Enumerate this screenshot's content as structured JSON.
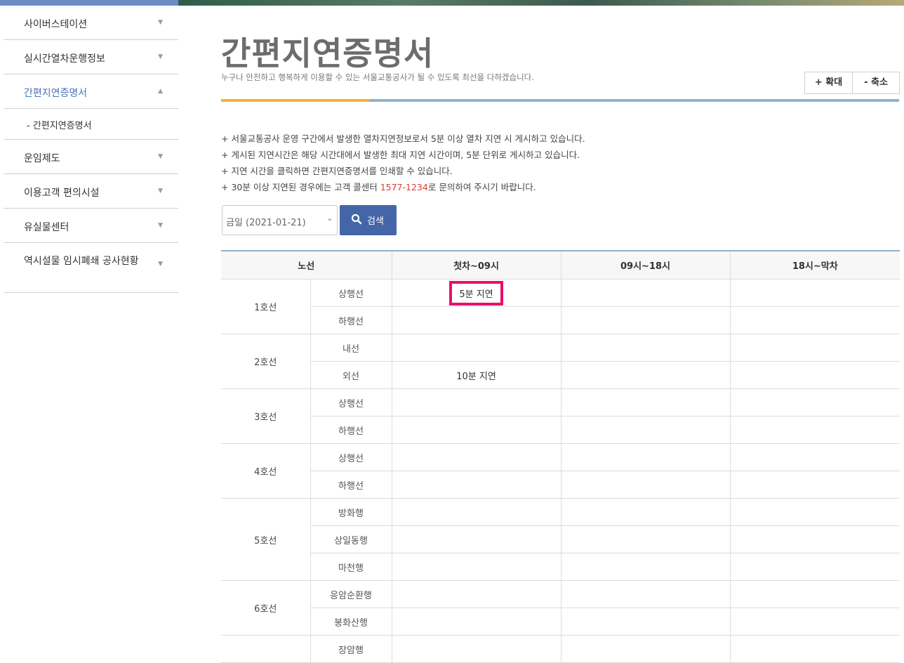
{
  "sidebar": {
    "items": [
      {
        "label": "사이버스테이션",
        "arrow": "▼"
      },
      {
        "label": "실시간열차운행정보",
        "arrow": "▼"
      },
      {
        "label": "간편지연증명서",
        "arrow": "▲"
      },
      {
        "label": "- 간편지연증명서"
      },
      {
        "label": "운임제도",
        "arrow": "▼"
      },
      {
        "label": "이용고객 편의시설",
        "arrow": "▼"
      },
      {
        "label": "유실물센터",
        "arrow": "▼"
      },
      {
        "label": "역시설물 임시폐쇄 공사현황",
        "arrow": "▼"
      }
    ]
  },
  "header": {
    "title": "간편지연증명서",
    "subtitle": "누구나 안전하고 행복하게 이용할 수 있는 서울교통공사가 될 수 있도록 최선을 다하겠습니다.",
    "zoom_in": "+ 확대",
    "zoom_out": "- 축소"
  },
  "notices": {
    "line1": "+ 서울교통공사 운영 구간에서 발생한 열차지연정보로서 5분 이상 열차 지연 시 게시하고 있습니다.",
    "line2": "+ 게시된 지연시간은 해당 시간대에서 발생한 최대 지연 시간이며, 5분 단위로 게시하고 있습니다.",
    "line3": "+ 지연 시간을 클릭하면 간편지연증명서를 인쇄할 수 있습니다.",
    "line4_prefix": "+ 30분 이상 지연된 경우에는 고객 콜센터 ",
    "phone": "1577-1234",
    "line4_suffix": "로 문의하여 주시기 바랍니다."
  },
  "search": {
    "date_value": "금일 (2021-01-21)",
    "button_label": "검색"
  },
  "table": {
    "headers": [
      "노선",
      "첫차~09시",
      "09시~18시",
      "18시~막차"
    ],
    "lines": [
      {
        "name": "1호선",
        "directions": [
          "상행선",
          "하행선"
        ]
      },
      {
        "name": "2호선",
        "directions": [
          "내선",
          "외선"
        ]
      },
      {
        "name": "3호선",
        "directions": [
          "상행선",
          "하행선"
        ]
      },
      {
        "name": "4호선",
        "directions": [
          "상행선",
          "하행선"
        ]
      },
      {
        "name": "5호선",
        "directions": [
          "방화행",
          "상일동행",
          "마천행"
        ]
      },
      {
        "name": "6호선",
        "directions": [
          "응암순환행",
          "봉화산행"
        ]
      },
      {
        "name": "",
        "directions": [
          "장암행"
        ]
      }
    ],
    "delays": {
      "line1_up_early": "5분 지연",
      "line2_outer_early": "10분 지연"
    }
  },
  "colors": {
    "accent_blue": "#4465a8",
    "highlight": "#ea0f6b",
    "phone_red": "#e03c31",
    "rule_yellow": "#f3b332"
  }
}
